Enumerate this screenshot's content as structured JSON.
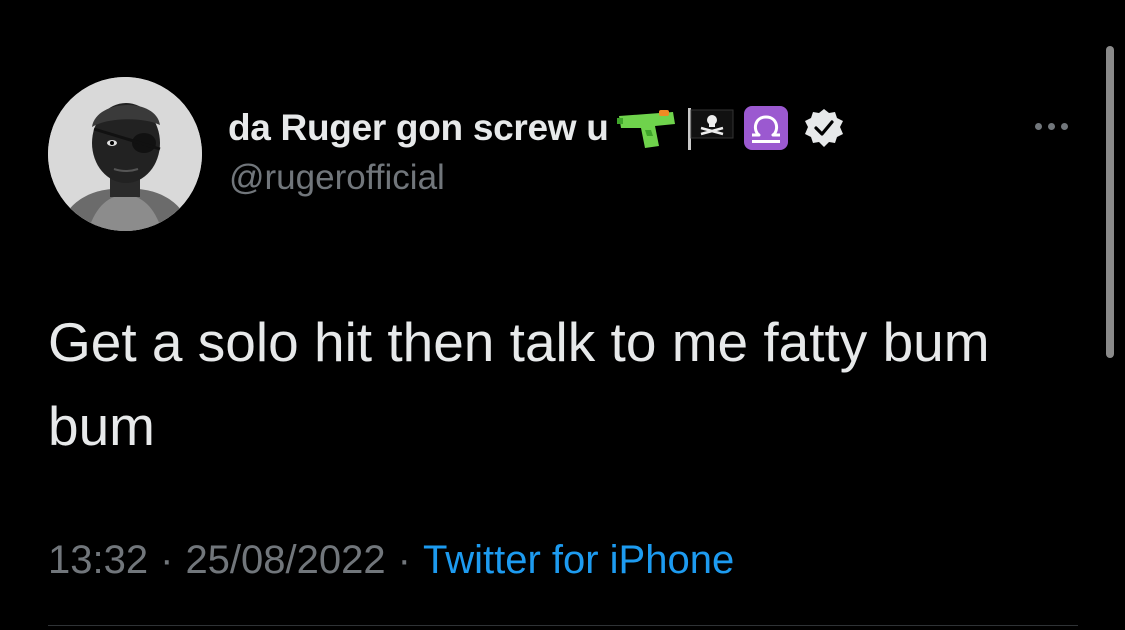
{
  "author": {
    "display_name": "da Ruger gon screw u",
    "handle": "@rugerofficial",
    "name_emojis": [
      "water-pistol-icon",
      "pirate-flag-icon",
      "libra-icon"
    ],
    "verified": true,
    "avatar": "avatar-photo"
  },
  "tweet": {
    "text": "Get a solo hit then talk to me fatty bum bum",
    "time": "13:32",
    "date": "25/08/2022",
    "separator": "·",
    "source": "Twitter for iPhone"
  },
  "colors": {
    "background": "#000000",
    "primary_text": "#e7e9ea",
    "secondary_text": "#71767b",
    "link": "#1d9bf0",
    "libra_badge": "#9b59d0"
  }
}
